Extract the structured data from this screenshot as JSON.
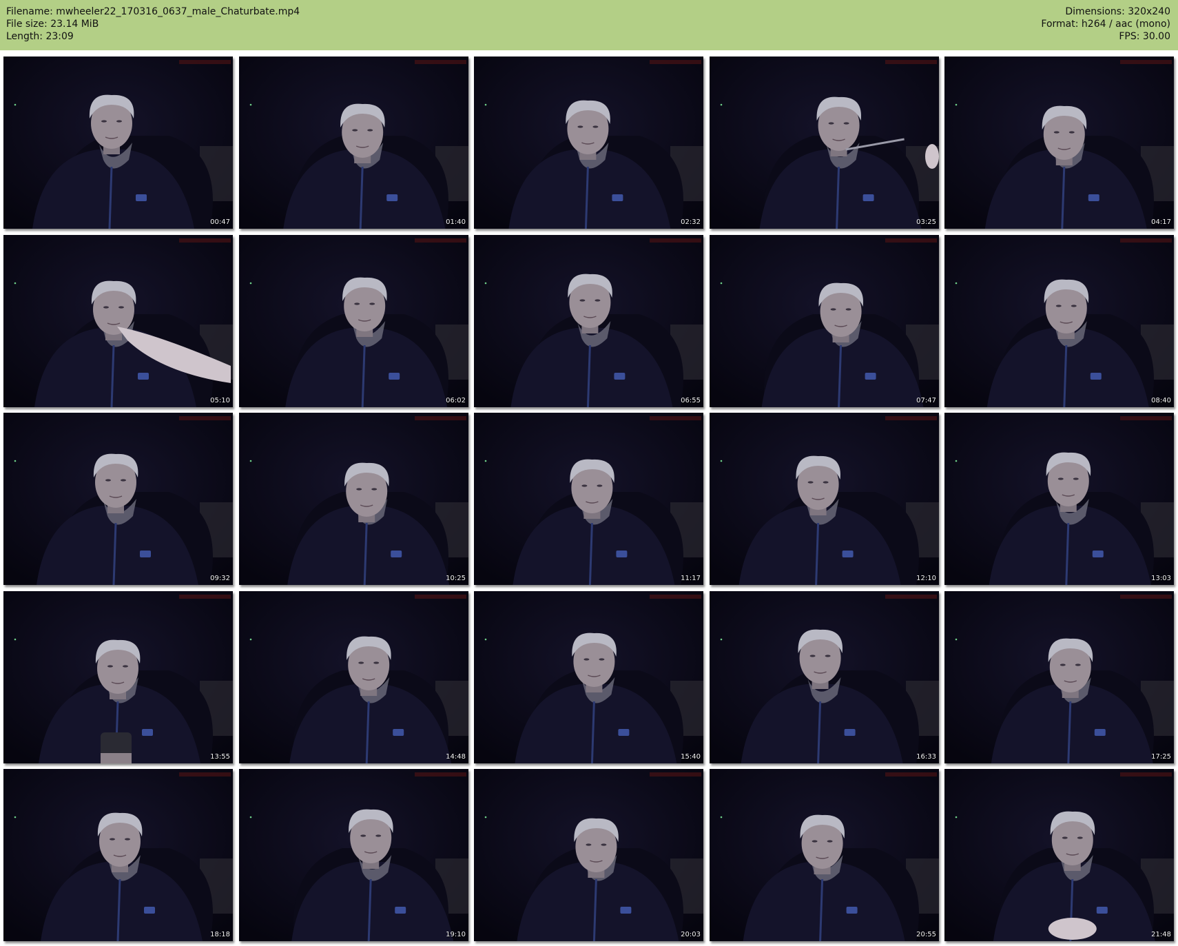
{
  "header": {
    "filename": "Filename: mwheeler22_170316_0637_male_Chaturbate.mp4",
    "filesize": "File size: 23.14 MiB",
    "length": "Length: 23:09",
    "dimensions": "Dimensions: 320x240",
    "format": "Format: h264 / aac (mono)",
    "fps": "FPS: 30.00"
  },
  "colors": {
    "header_bg": "#b3cf86",
    "frame_bg": "#06050f",
    "hoodie": "#14132a",
    "skin": "#9a8f97",
    "hair": "#b9b9c4",
    "watermark": "#5a1414"
  },
  "thumbnails": [
    {
      "time": "00:47",
      "hand": "none"
    },
    {
      "time": "01:40",
      "hand": "none"
    },
    {
      "time": "02:32",
      "hand": "none"
    },
    {
      "time": "03:25",
      "hand": "earbud"
    },
    {
      "time": "04:17",
      "hand": "none"
    },
    {
      "time": "05:10",
      "hand": "chin"
    },
    {
      "time": "06:02",
      "hand": "none"
    },
    {
      "time": "06:55",
      "hand": "none"
    },
    {
      "time": "07:47",
      "hand": "none"
    },
    {
      "time": "08:40",
      "hand": "none"
    },
    {
      "time": "09:32",
      "hand": "none"
    },
    {
      "time": "10:25",
      "hand": "none"
    },
    {
      "time": "11:17",
      "hand": "none"
    },
    {
      "time": "12:10",
      "hand": "none"
    },
    {
      "time": "13:03",
      "hand": "none"
    },
    {
      "time": "13:55",
      "hand": "phone"
    },
    {
      "time": "14:48",
      "hand": "none"
    },
    {
      "time": "15:40",
      "hand": "none"
    },
    {
      "time": "16:33",
      "hand": "none"
    },
    {
      "time": "17:25",
      "hand": "none"
    },
    {
      "time": "18:18",
      "hand": "none"
    },
    {
      "time": "19:10",
      "hand": "none"
    },
    {
      "time": "20:03",
      "hand": "none"
    },
    {
      "time": "20:55",
      "hand": "none"
    },
    {
      "time": "21:48",
      "hand": "clasped"
    }
  ]
}
